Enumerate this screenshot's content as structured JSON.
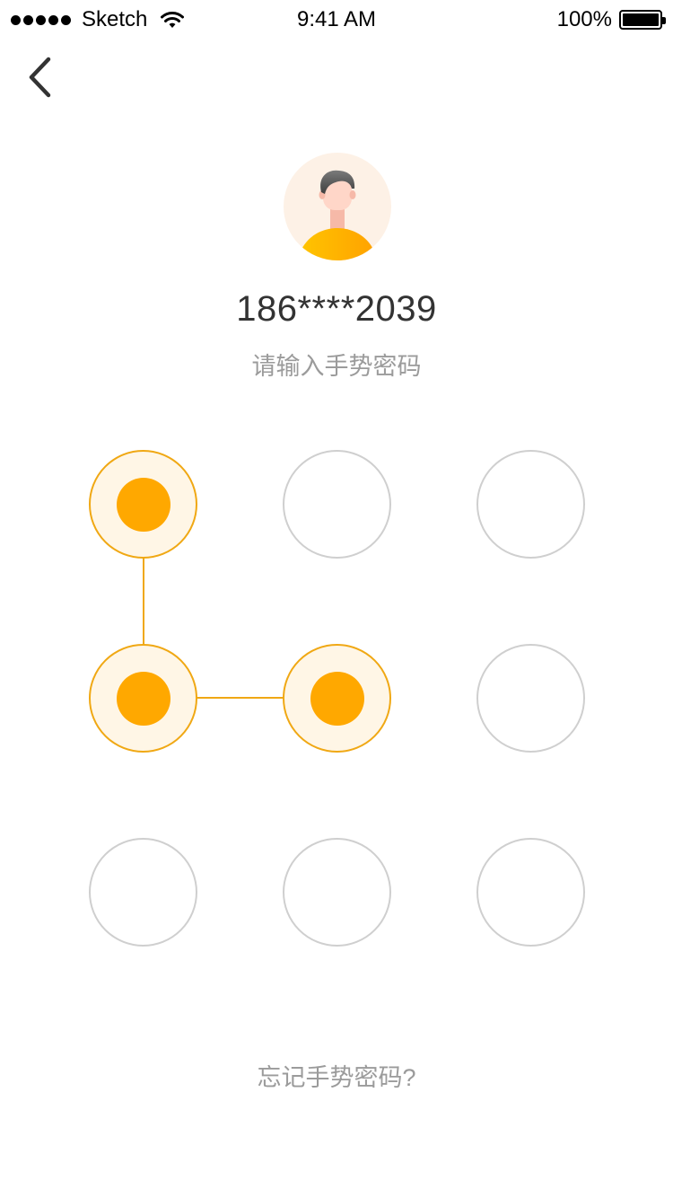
{
  "status_bar": {
    "carrier": "Sketch",
    "time": "9:41 AM",
    "battery": "100%"
  },
  "user": {
    "phone": "186****2039"
  },
  "prompt": {
    "hint": "请输入手势密码"
  },
  "gesture": {
    "selected": [
      0,
      3,
      4
    ],
    "colors": {
      "active_border": "#f0a814",
      "active_fill": "#fff6e6",
      "active_core": "#ffa800",
      "inactive_border": "#cfcfcf"
    }
  },
  "footer": {
    "forgot_link": "忘记手势密码?"
  },
  "icons": {
    "back": "chevron-left-icon",
    "wifi": "wifi-icon",
    "battery": "battery-icon"
  }
}
